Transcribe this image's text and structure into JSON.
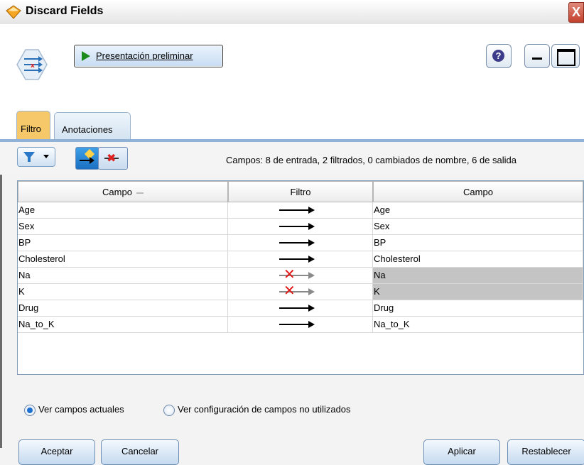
{
  "window": {
    "title": "Discard Fields",
    "close_glyph": "X"
  },
  "toolbar": {
    "preview_label": "Presentación preliminar",
    "help_glyph": "?"
  },
  "tabs": [
    {
      "label": "Filtro",
      "active": true
    },
    {
      "label": "Anotaciones",
      "active": false
    }
  ],
  "summary": "Campos: 8 de entrada, 2 filtrados, 0 cambiados de nombre, 6 de salida",
  "table": {
    "headers": [
      "Campo",
      "Filtro",
      "Campo"
    ],
    "rows": [
      {
        "input": "Age",
        "filtered": false,
        "output": "Age"
      },
      {
        "input": "Sex",
        "filtered": false,
        "output": "Sex"
      },
      {
        "input": "BP",
        "filtered": false,
        "output": "BP"
      },
      {
        "input": "Cholesterol",
        "filtered": false,
        "output": "Cholesterol"
      },
      {
        "input": "Na",
        "filtered": true,
        "output": "Na"
      },
      {
        "input": "K",
        "filtered": true,
        "output": "K"
      },
      {
        "input": "Drug",
        "filtered": false,
        "output": "Drug"
      },
      {
        "input": "Na_to_K",
        "filtered": false,
        "output": "Na_to_K"
      }
    ]
  },
  "view_options": {
    "current": "Ver campos actuales",
    "unused": "Ver configuración de campos no utilizados",
    "selected": "current"
  },
  "buttons": {
    "ok": "Aceptar",
    "cancel": "Cancelar",
    "apply": "Aplicar",
    "reset": "Restablecer"
  },
  "icons": {
    "title": "diamond-node-icon",
    "node": "filter-node-icon",
    "preview": "play-icon",
    "help": "help-icon",
    "minimize": "minimize-icon",
    "maximize": "maximize-icon",
    "filter_dropdown": "funnel-icon",
    "mode_pass": "pass-through-icon",
    "mode_remove": "remove-fields-icon"
  },
  "colors": {
    "active_tab": "#f6c86a",
    "filtered_cell": "#c4c4c4",
    "drop_x": "#e01818"
  }
}
